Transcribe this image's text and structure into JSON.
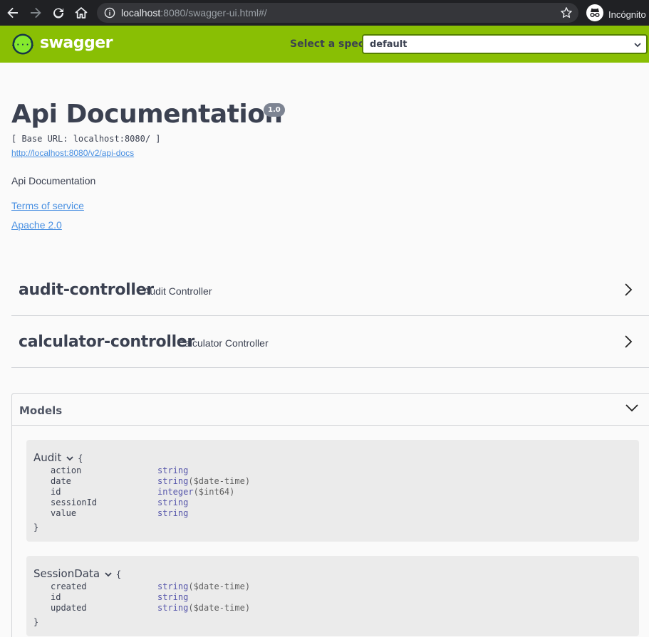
{
  "browser": {
    "url_host": "localhost",
    "url_rest": ":8080/swagger-ui.html#/",
    "profile_label": "Incógnito"
  },
  "topbar": {
    "logo_text": "swagger",
    "spec_label": "Select a spec",
    "spec_value": "default"
  },
  "info": {
    "title": "Api Documentation",
    "version": "1.0",
    "base_url": "[ Base URL: localhost:8080/ ]",
    "docs_link": "http://localhost:8080/v2/api-docs",
    "description": "Api Documentation",
    "terms_link": "Terms of service",
    "license_link": "Apache 2.0"
  },
  "controllers": [
    {
      "name": "audit-controller",
      "description": "Audit Controller"
    },
    {
      "name": "calculator-controller",
      "description": "Calculator Controller"
    }
  ],
  "models": {
    "title": "Models",
    "items": [
      {
        "name": "Audit",
        "open_brace": "{",
        "close_brace": "}",
        "properties": [
          {
            "name": "action",
            "type": "string",
            "format": ""
          },
          {
            "name": "date",
            "type": "string",
            "format": "($date-time)"
          },
          {
            "name": "id",
            "type": "integer",
            "format": "($int64)"
          },
          {
            "name": "sessionId",
            "type": "string",
            "format": ""
          },
          {
            "name": "value",
            "type": "string",
            "format": ""
          }
        ]
      },
      {
        "name": "SessionData",
        "open_brace": "{",
        "close_brace": "}",
        "properties": [
          {
            "name": "created",
            "type": "string",
            "format": "($date-time)"
          },
          {
            "name": "id",
            "type": "string",
            "format": ""
          },
          {
            "name": "updated",
            "type": "string",
            "format": "($date-time)"
          }
        ]
      }
    ]
  },
  "colors": {
    "topbar_green": "#89bf04",
    "link_blue": "#4990e2",
    "text_dark": "#3b4151",
    "type_blue": "#5555aa"
  }
}
